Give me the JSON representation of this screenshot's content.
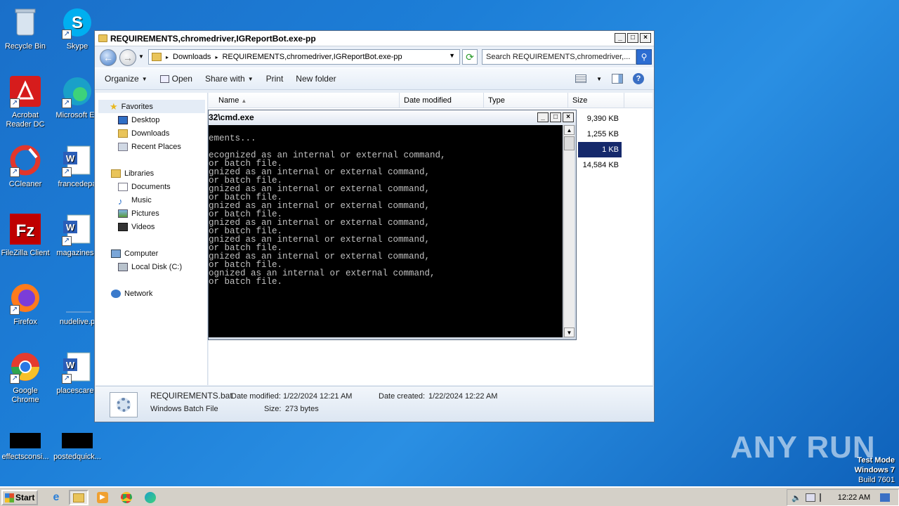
{
  "desktop": {
    "icons": [
      {
        "label": "Recycle Bin"
      },
      {
        "label": "Skype"
      },
      {
        "label": "Acrobat Reader DC"
      },
      {
        "label": "Microsoft Ed"
      },
      {
        "label": "CCleaner"
      },
      {
        "label": "francedepa"
      },
      {
        "label": "FileZilla Client"
      },
      {
        "label": "magazinesp"
      },
      {
        "label": "Firefox"
      },
      {
        "label": "nudelive.p"
      },
      {
        "label": "Google Chrome"
      },
      {
        "label": "placescaree"
      },
      {
        "label": "effectsconsi..."
      },
      {
        "label": "postedquick..."
      }
    ]
  },
  "explorer": {
    "title": "REQUIREMENTS,chromedriver,IGReportBot.exe-pp",
    "breadcrumb": [
      "Downloads",
      "REQUIREMENTS,chromedriver,IGReportBot.exe-pp"
    ],
    "search_placeholder": "Search REQUIREMENTS,chromedriver,...",
    "toolbar": {
      "organize": "Organize",
      "open": "Open",
      "share_with": "Share with",
      "print": "Print",
      "new_folder": "New folder"
    },
    "nav": {
      "favorites": "Favorites",
      "desktop": "Desktop",
      "downloads": "Downloads",
      "recent": "Recent Places",
      "libraries": "Libraries",
      "documents": "Documents",
      "music": "Music",
      "pictures": "Pictures",
      "videos": "Videos",
      "computer": "Computer",
      "local_disk": "Local Disk (C:)",
      "network": "Network"
    },
    "columns": {
      "name": "Name",
      "date_modified": "Date modified",
      "type": "Type",
      "size": "Size"
    },
    "sizes": [
      "9,390 KB",
      "1,255 KB",
      "1 KB",
      "14,584 KB"
    ],
    "details": {
      "filename": "REQUIREMENTS.bat",
      "filetype": "Windows Batch File",
      "date_modified_label": "Date modified:",
      "date_modified": "1/22/2024 12:21 AM",
      "date_created_label": "Date created:",
      "date_created": "1/22/2024 12:22 AM",
      "size_label": "Size:",
      "size": "273 bytes"
    }
  },
  "cmd": {
    "title": "32\\cmd.exe",
    "lines": [
      "ements...",
      "",
      "ecognized as an internal or external command,",
      "or batch file.",
      "gnized as an internal or external command,",
      "or batch file.",
      "gnized as an internal or external command,",
      "or batch file.",
      "gnized as an internal or external command,",
      "or batch file.",
      "gnized as an internal or external command,",
      "or batch file.",
      "gnized as an internal or external command,",
      "or batch file.",
      "gnized as an internal or external command,",
      "or batch file.",
      "ognized as an internal or external command,",
      "or batch file."
    ]
  },
  "taskbar": {
    "start": "Start",
    "clock": "12:22 AM"
  },
  "watermark": {
    "brand": "ANY RUN",
    "test_mode": "Test Mode",
    "os": "Windows 7",
    "build": "Build 7601"
  },
  "colors": {
    "desktop_bg": "#1d7fd8",
    "selection": "#15296b",
    "console_bg": "#000000",
    "console_fg": "#c0c0c0"
  }
}
